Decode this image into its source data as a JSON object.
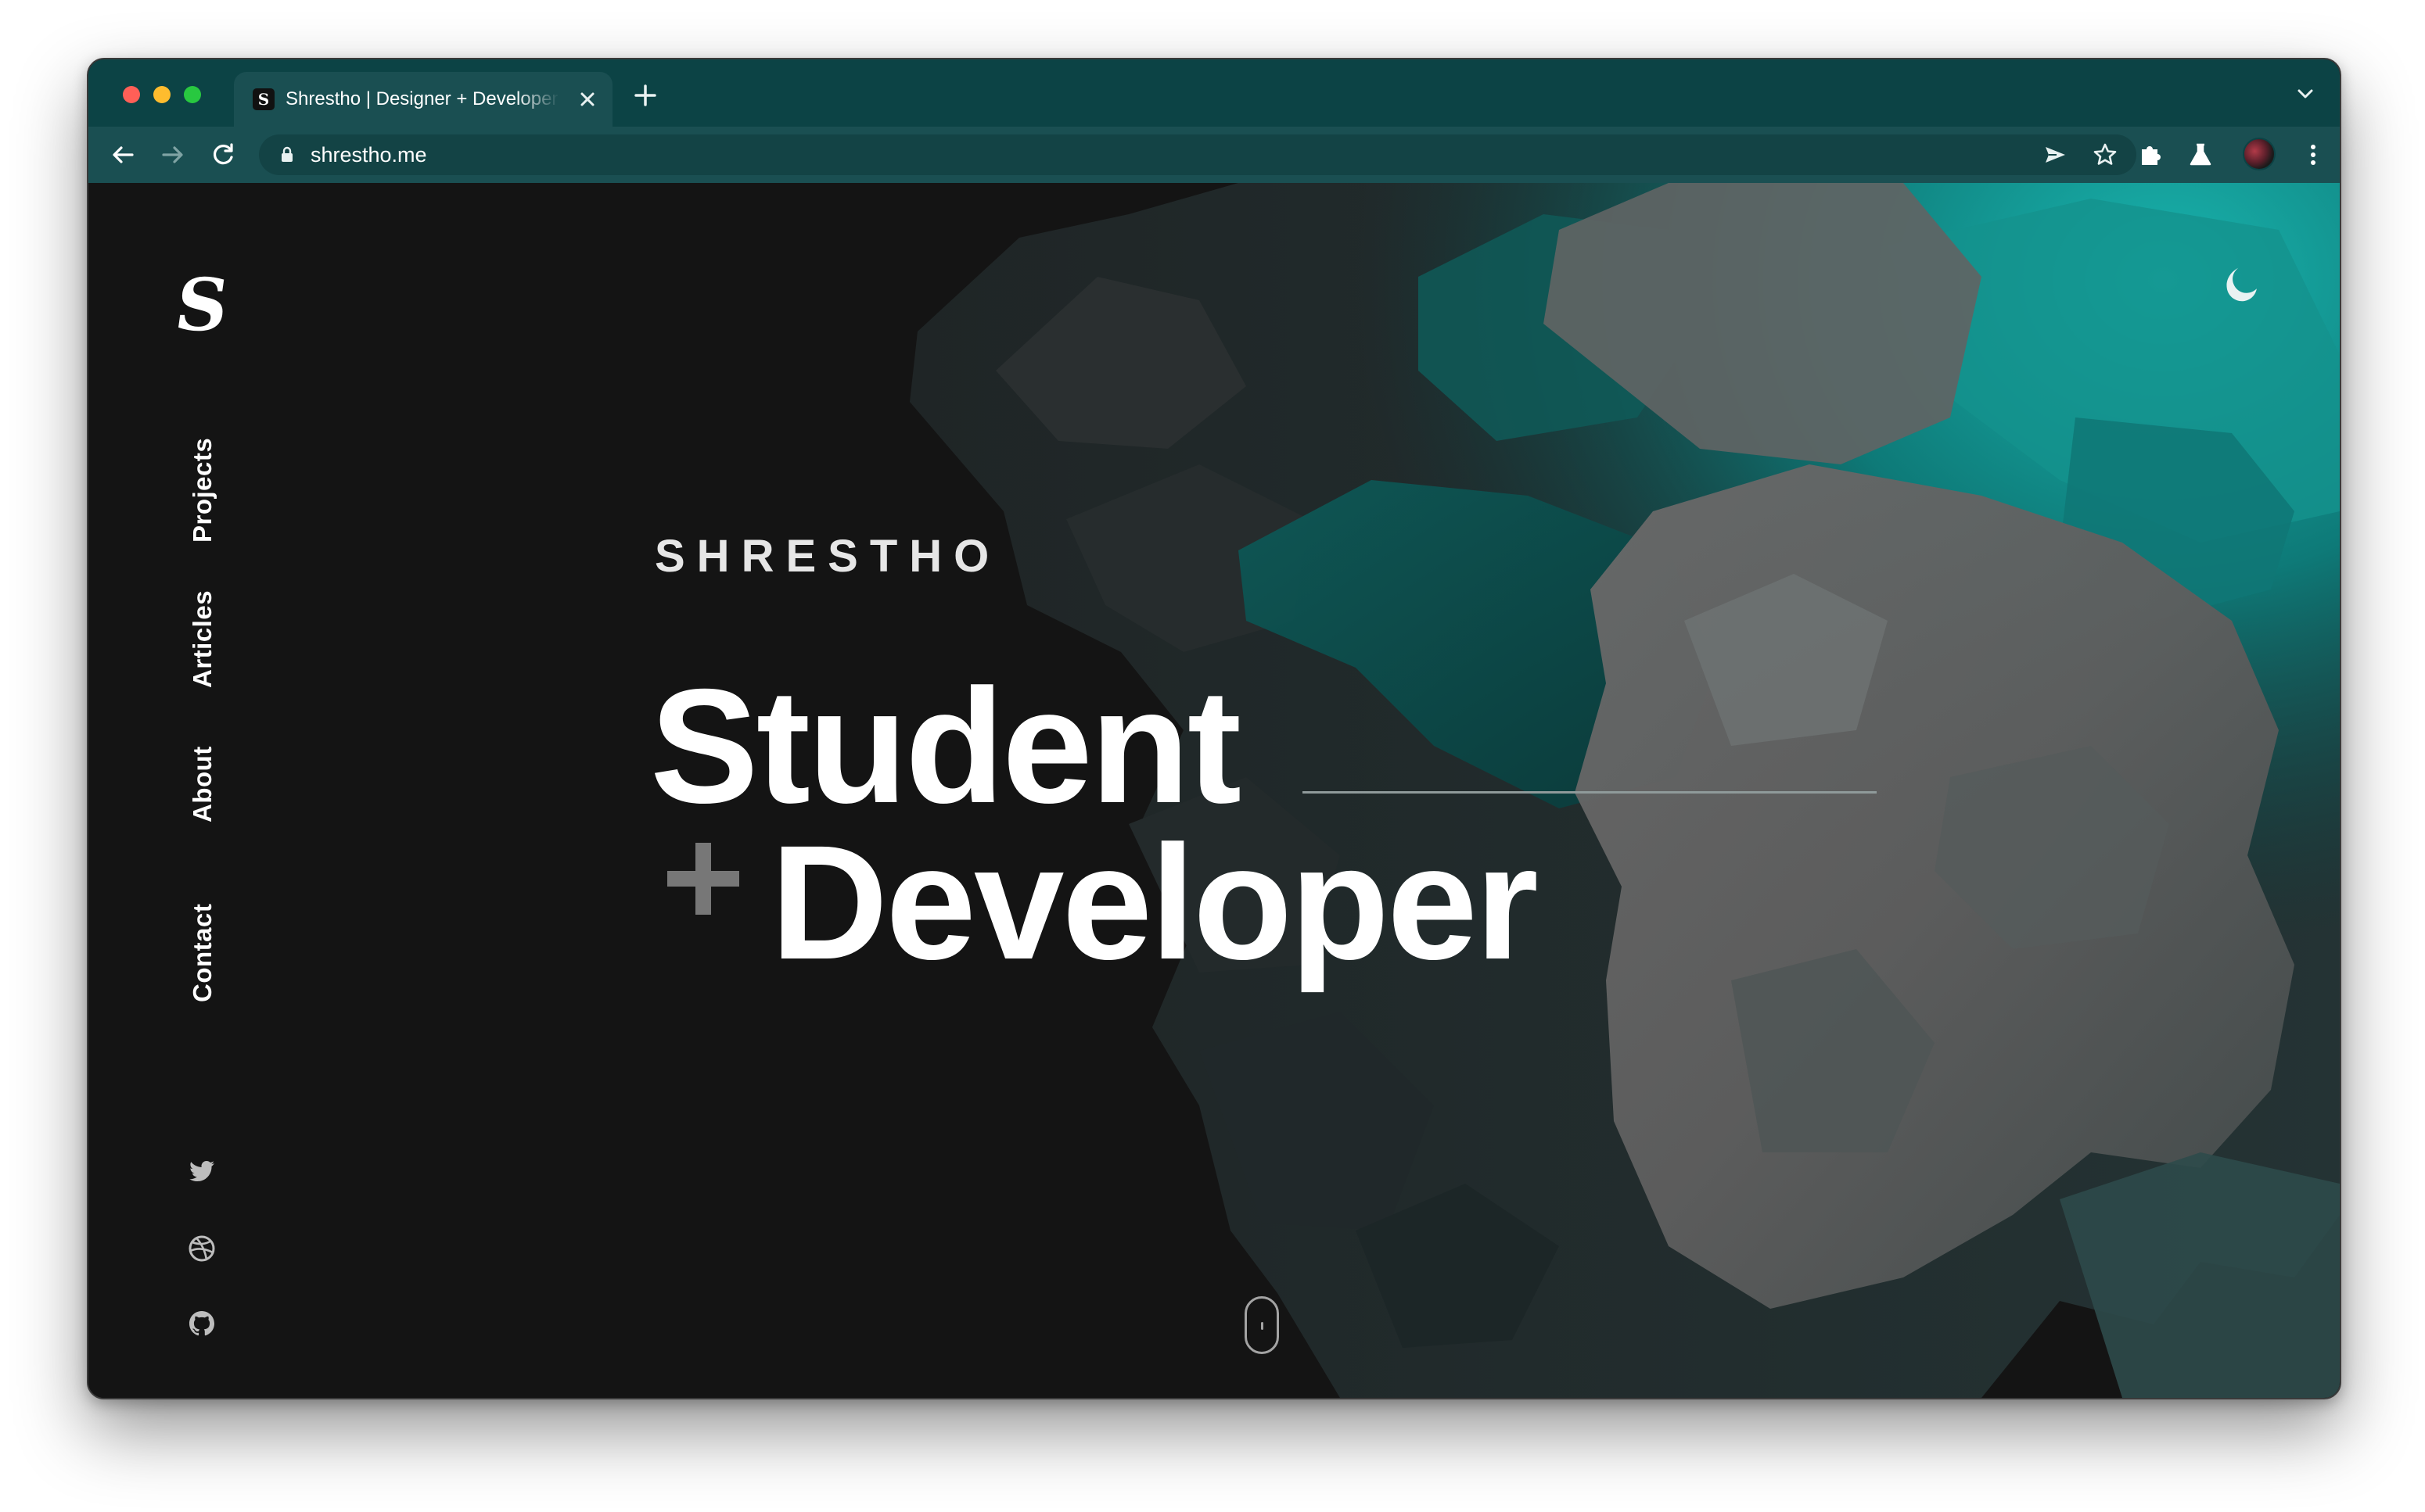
{
  "browser": {
    "tab_title": "Shrestho | Designer + Developer",
    "favicon_glyph": "S",
    "url": "shrestho.me",
    "new_tab_icon": "plus-icon",
    "close_tab_icon": "close-icon"
  },
  "site": {
    "logo_glyph": "S",
    "nav": {
      "projects": "Projects",
      "articles": "Articles",
      "about": "About",
      "contact": "Contact"
    },
    "social_icons": [
      "twitter-icon",
      "dribbble-icon",
      "github-icon"
    ],
    "theme_icon": "moon-icon"
  },
  "hero": {
    "eyebrow": "SHRESTHO",
    "line1": "Student",
    "line2": "Developer",
    "plus_icon": "plus-icon"
  },
  "colors": {
    "tab_strip": "#0c4345",
    "toolbar": "#1a4f52",
    "page_background": "#141414",
    "accent_teal": "#13a6a3",
    "plus_gray": "#777777"
  }
}
